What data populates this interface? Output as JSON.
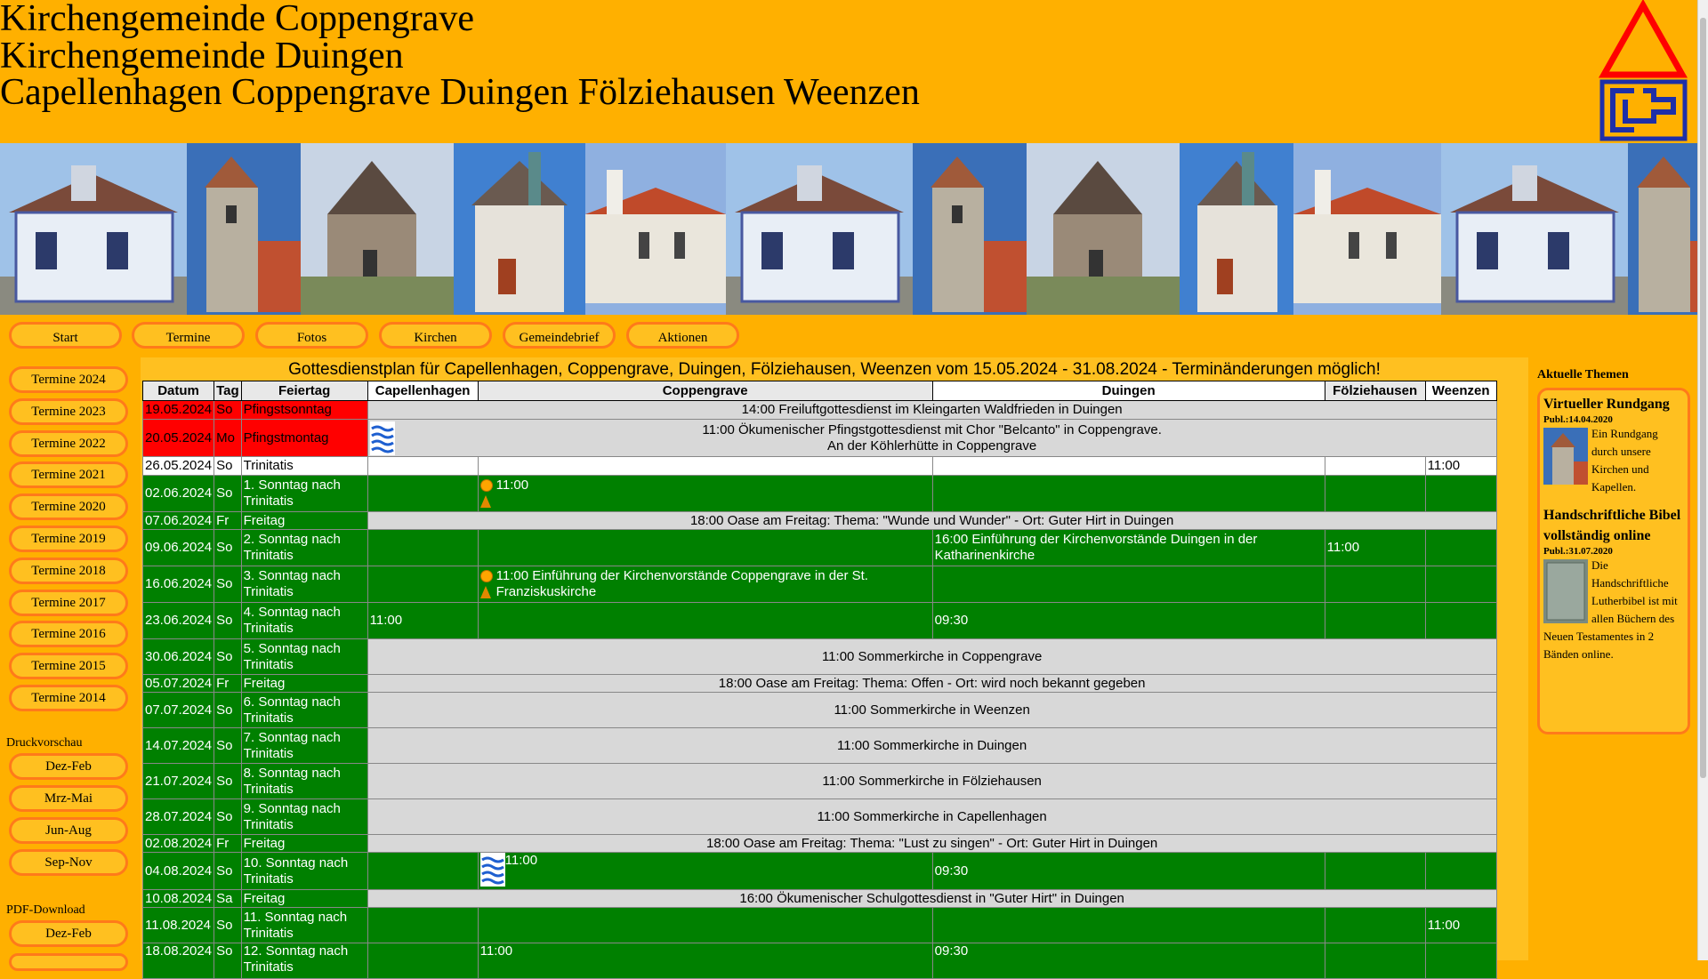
{
  "header": {
    "line1": "Kirchengemeinde Coppengrave",
    "line2": "Kirchengemeinde Duingen",
    "line3": "Capellenhagen Coppengrave Duingen Fölziehausen Weenzen"
  },
  "nav": {
    "items": [
      "Start",
      "Termine",
      "Fotos",
      "Kirchen",
      "Gemeindebrief",
      "Aktionen"
    ]
  },
  "sidebar": {
    "years": [
      "Termine 2024",
      "Termine 2023",
      "Termine 2022",
      "Termine 2021",
      "Termine 2020",
      "Termine 2019",
      "Termine 2018",
      "Termine 2017",
      "Termine 2016",
      "Termine 2015",
      "Termine 2014"
    ],
    "print_heading": "Druckvorschau",
    "print_items": [
      "Dez-Feb",
      "Mrz-Mai",
      "Jun-Aug",
      "Sep-Nov"
    ],
    "pdf_heading": "PDF-Download",
    "pdf_items": [
      "Dez-Feb"
    ]
  },
  "plan": {
    "title": "Gottesdienstplan für Capellenhagen, Coppengrave, Duingen, Fölziehausen, Weenzen vom 15.05.2024 - 31.08.2024 - Terminänderungen möglich!",
    "headers": [
      "Datum",
      "Tag",
      "Feiertag",
      "Capellenhagen",
      "Coppengrave",
      "Duingen",
      "Fölziehausen",
      "Weenzen"
    ],
    "rows": [
      {
        "date": "19.05.2024",
        "day": "So",
        "holiday": "Pfingstsonntag",
        "merged": "14:00 Freiluftgottesdienst im Kleingarten Waldfrieden in Duingen"
      },
      {
        "date": "20.05.2024",
        "day": "Mo",
        "holiday": "Pfingstmontag",
        "merged": "11:00 Ökumenischer Pfingstgottesdienst mit Chor \"Belcanto\" in Coppengrave.",
        "merged2": "An der Köhlerhütte in Coppengrave"
      },
      {
        "date": "26.05.2024",
        "day": "So",
        "holiday": "Trinitatis",
        "weenzen": "11:00"
      },
      {
        "date": "02.06.2024",
        "day": "So",
        "holiday": "1. Sonntag nach Trinitatis",
        "coppengrave": "11:00"
      },
      {
        "date": "07.06.2024",
        "day": "Fr",
        "holiday": "Freitag",
        "merged": "18:00 Oase am Freitag: Thema: \"Wunde und Wunder\" - Ort: Guter Hirt in Duingen"
      },
      {
        "date": "09.06.2024",
        "day": "So",
        "holiday": "2. Sonntag nach Trinitatis",
        "duingen": "16:00 Einführung der Kirchenvorstände Duingen in der Katharinenkirche",
        "foelziehausen": "11:00"
      },
      {
        "date": "16.06.2024",
        "day": "So",
        "holiday": "3. Sonntag nach Trinitatis",
        "coppengrave": "11:00 Einführung der Kirchenvorstände Coppengrave in der St. Franziskuskirche"
      },
      {
        "date": "23.06.2024",
        "day": "So",
        "holiday": "4. Sonntag nach Trinitatis",
        "capellenhagen": "11:00",
        "duingen": "09:30"
      },
      {
        "date": "30.06.2024",
        "day": "So",
        "holiday": "5. Sonntag nach Trinitatis",
        "merged": "11:00 Sommerkirche in Coppengrave"
      },
      {
        "date": "05.07.2024",
        "day": "Fr",
        "holiday": "Freitag",
        "merged": "18:00 Oase am Freitag: Thema: Offen - Ort: wird noch bekannt gegeben"
      },
      {
        "date": "07.07.2024",
        "day": "So",
        "holiday": "6. Sonntag nach Trinitatis",
        "merged": "11:00 Sommerkirche in Weenzen"
      },
      {
        "date": "14.07.2024",
        "day": "So",
        "holiday": "7. Sonntag nach Trinitatis",
        "merged": "11:00 Sommerkirche in Duingen"
      },
      {
        "date": "21.07.2024",
        "day": "So",
        "holiday": "8. Sonntag nach Trinitatis",
        "merged": "11:00 Sommerkirche in Fölziehausen"
      },
      {
        "date": "28.07.2024",
        "day": "So",
        "holiday": "9. Sonntag nach Trinitatis",
        "merged": "11:00 Sommerkirche in Capellenhagen"
      },
      {
        "date": "02.08.2024",
        "day": "Fr",
        "holiday": "Freitag",
        "merged": "18:00 Oase am Freitag: Thema: \"Lust zu singen\" - Ort: Guter Hirt in Duingen"
      },
      {
        "date": "04.08.2024",
        "day": "So",
        "holiday": "10. Sonntag nach Trinitatis",
        "coppengrave": "11:00",
        "duingen": "09:30"
      },
      {
        "date": "10.08.2024",
        "day": "Sa",
        "holiday": "Freitag",
        "merged": "16:00 Ökumenischer Schulgottesdienst in \"Guter Hirt\" in Duingen"
      },
      {
        "date": "11.08.2024",
        "day": "So",
        "holiday": "11. Sonntag nach Trinitatis",
        "weenzen": "11:00"
      },
      {
        "date": "18.08.2024",
        "day": "So",
        "holiday": "12. Sonntag nach Trinitatis",
        "coppengrave": "11:00",
        "duingen": "09:30"
      }
    ]
  },
  "right": {
    "heading": "Aktuelle Themen",
    "news": [
      {
        "title": "Virtueller Rundgang",
        "date": "Publ.:14.04.2020",
        "body": "Ein Rundgang durch unsere Kirchen und Kapellen."
      },
      {
        "title": "Handschriftliche Bibel vollständig online",
        "date": "Publ.:31.07.2020",
        "body": "Die Handschriftliche Lutherbibel ist mit allen Büchern des Neuen Testamentes in 2 Bänden online."
      }
    ]
  },
  "colors": {
    "background": "#FFB000",
    "button_border": "#FF7A1A",
    "row_green": "#008000",
    "row_red": "#FF0000",
    "merged_grey": "#D8D8D8"
  }
}
